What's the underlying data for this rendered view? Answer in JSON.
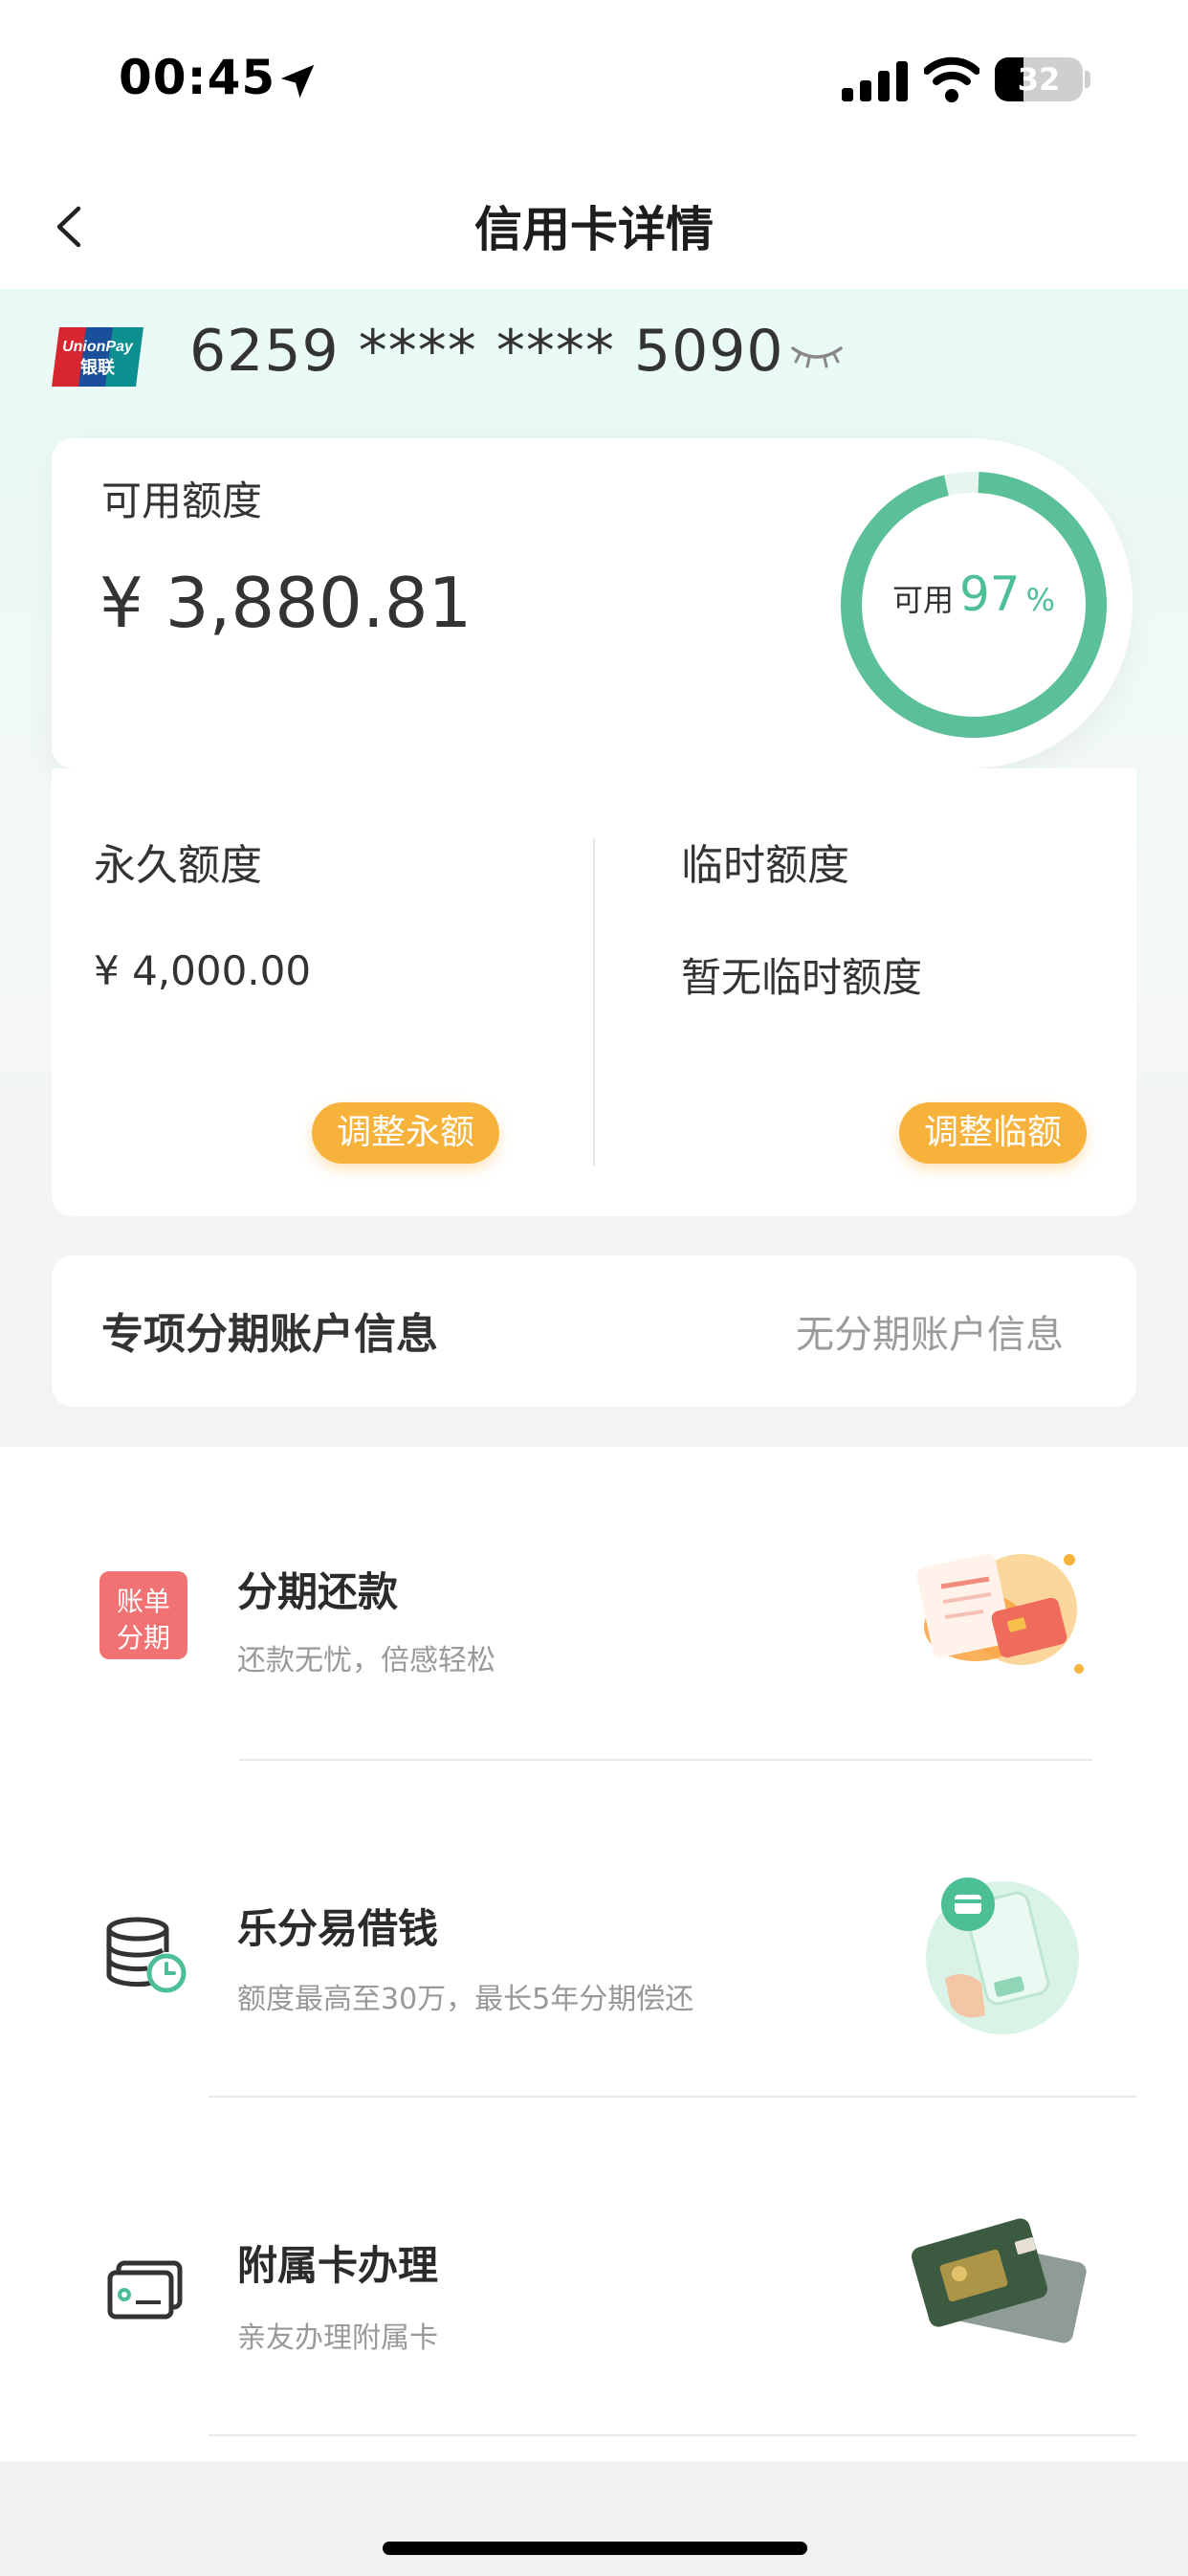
{
  "status": {
    "time": "00:45",
    "battery": "32"
  },
  "nav": {
    "title": "信用卡详情"
  },
  "card": {
    "number": "6259 **** **** 5090"
  },
  "available": {
    "label": "可用额度",
    "amount": "¥ 3,880.81",
    "ring_label": "可用",
    "ring_percent": "97",
    "ring_unit": "%",
    "percent_value": 0.97
  },
  "limits": {
    "permanent_title": "永久额度",
    "permanent_value": "¥ 4,000.00",
    "adjust_permanent": "调整永额",
    "temporary_title": "临时额度",
    "temporary_value": "暂无临时额度",
    "adjust_temporary": "调整临额"
  },
  "installment_account": {
    "title": "专项分期账户信息",
    "value": "无分期账户信息"
  },
  "services": [
    {
      "title": "分期还款",
      "subtitle": "还款无忧，倍感轻松",
      "badge_line1": "账单",
      "badge_line2": "分期"
    },
    {
      "title": "乐分易借钱",
      "subtitle": "额度最高至30万，最长5年分期偿还"
    },
    {
      "title": "附属卡办理",
      "subtitle": "亲友办理附属卡"
    }
  ],
  "colors": {
    "accent_green": "#4cbf95",
    "button_orange": "#f6b23b",
    "badge_red": "#f07272"
  }
}
